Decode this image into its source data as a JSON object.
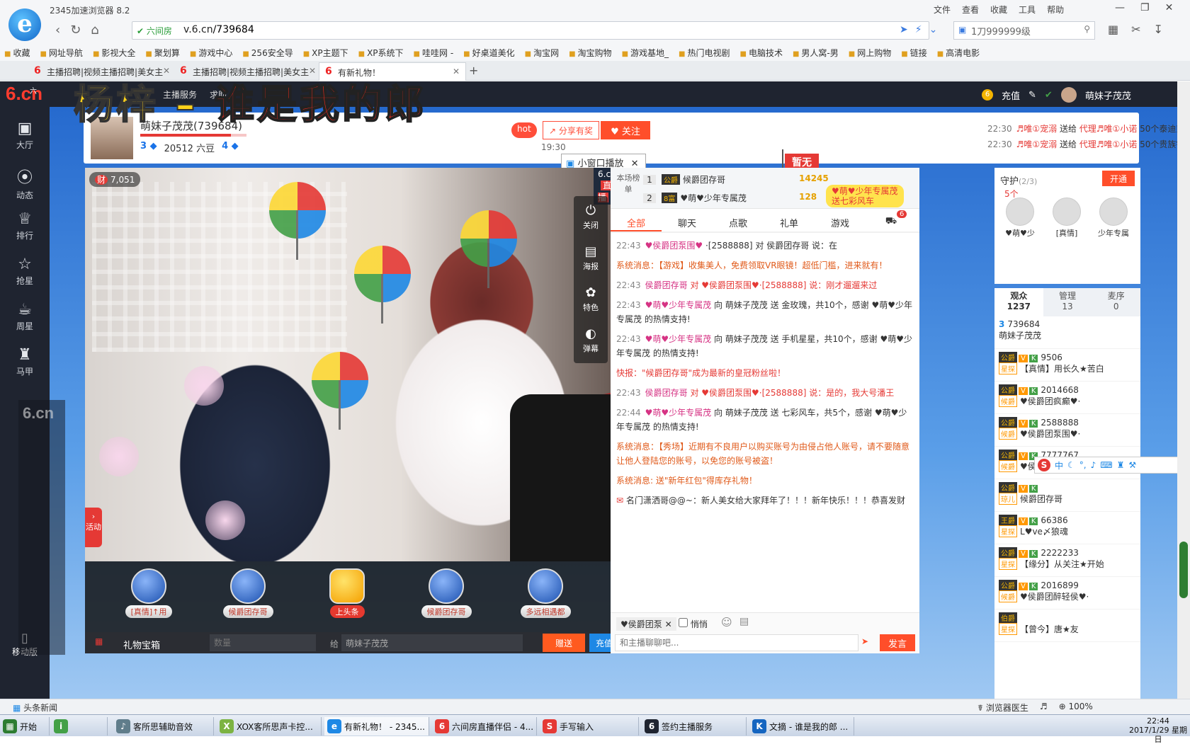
{
  "browser": {
    "title": "2345加速浏览器 8.2",
    "menu": [
      "文件",
      "查看",
      "收藏",
      "工具",
      "帮助"
    ],
    "safe_label": "六间房",
    "url_host": "v.6.cn",
    "url_path": "/739684",
    "search_value": "1刀999999级",
    "bookmarks": [
      "收藏",
      "网址导航",
      "影视大全",
      "聚划算",
      "游戏中心",
      "256安全导",
      "XP主题下",
      "XP系统下",
      "哇哇网 -",
      "好桌道美化",
      "淘宝网",
      "淘宝购物",
      "游戏基地_",
      "热门电视剧",
      "电脑技术",
      "男人窝-男",
      "网上购物",
      "链接",
      "高清电影"
    ],
    "tabs": [
      {
        "label": "主播招聘|视频主播招聘|美女主"
      },
      {
        "label": "主播招聘|视频主播招聘|美女主"
      },
      {
        "label": "有新礼物！"
      }
    ]
  },
  "site": {
    "logo_main": "6.cn",
    "logo_small": "六间房",
    "nav_links": [
      "主播服务",
      "求助"
    ],
    "recharge": "充值",
    "username": "萌妹子茂茂"
  },
  "sidebar": [
    {
      "label": "大厅",
      "icon": "tv-icon"
    },
    {
      "label": "动态",
      "icon": "compass-icon"
    },
    {
      "label": "排行",
      "icon": "crown-icon"
    },
    {
      "label": "抢星",
      "icon": "star-icon"
    },
    {
      "label": "周星",
      "icon": "cup-icon"
    },
    {
      "label": "马甲",
      "icon": "shirt-icon"
    }
  ],
  "overlay_title": {
    "part1": "杨梓 – ",
    "part2": "谁是我的郎"
  },
  "host": {
    "name": "萌妹子茂茂(739684)",
    "level": "3",
    "beans": "20512 六豆",
    "fans_level": "4",
    "progress": 0.85,
    "hot": "hot",
    "share": "分享有奖",
    "follow": "关注",
    "time": "19:30",
    "mini_play": "小窗口播放",
    "flag": "暂无"
  },
  "gift_ticker": [
    {
      "time": "22:30",
      "from": "♬唯①宠溺",
      "verb": "送给",
      "to": "代理♬唯①小诺",
      "gift": "50个泰迪熊"
    },
    {
      "time": "22:30",
      "from": "♬唯①宠溺",
      "verb": "送给",
      "to": "代理♬唯①小诺",
      "gift": "50个贵族钻戒"
    }
  ],
  "video": {
    "viewers": "7,051",
    "brand": "6.cn",
    "live": "直播",
    "controls": [
      {
        "label": "关闭",
        "icon": "power-icon"
      },
      {
        "label": "海报",
        "icon": "image-icon"
      },
      {
        "label": "特色",
        "icon": "sparkle-icon"
      },
      {
        "label": "弹幕",
        "icon": "toggle-icon"
      }
    ],
    "activity": "活动"
  },
  "gift_slots": [
    {
      "label": "[真情]↑用"
    },
    {
      "label": "候爵团存哥"
    },
    {
      "label": "上头条"
    },
    {
      "label": "候爵团存哥"
    },
    {
      "label": "多远相遇都"
    }
  ],
  "gift_controls": {
    "box": "礼物宝箱",
    "quantity_placeholder": "数量",
    "to_label": "给",
    "to_value": "萌妹子茂茂",
    "give": "赠送",
    "recharge": "充值"
  },
  "rank": {
    "label": "本场榜单",
    "rows": [
      {
        "n": "1",
        "lv": "公爵",
        "name": "候爵团存哥",
        "pts": "14245"
      },
      {
        "n": "2",
        "lv": "8富",
        "name": "♥萌♥少年专属茂",
        "pts": "128"
      }
    ],
    "float_msg1": "♥萌♥少年专属茂",
    "float_msg2": "送七彩风车",
    "float_count": "5个"
  },
  "chat_tabs": [
    "全部",
    "聊天",
    "点歌",
    "礼单",
    "游戏"
  ],
  "chat_badge": "6",
  "messages": [
    {
      "t": "22:43",
      "u": "♥侯爵团泵围♥",
      "text": "·[2588888] 对 侯爵团存哥 说：在"
    },
    {
      "t": "",
      "u": "",
      "sys": "系统消息：【游戏】收集美人，免费领取VR眼镜！超低门槛，进来就有！"
    },
    {
      "t": "22:43",
      "u": "侯爵团存哥",
      "text": "对 ♥侯爵团泵围♥·[2588888] 说：刚才遛遛来过"
    },
    {
      "t": "22:43",
      "u": "♥萌♥少年专属茂",
      "text": "向 萌妹子茂茂 送 金玫瑰，共10个，感谢 ♥萌♥少年专属茂 的热情支持!"
    },
    {
      "t": "22:43",
      "u": "♥萌♥少年专属茂",
      "text": "向 萌妹子茂茂 送 手机星星，共10个，感谢 ♥萌♥少年专属茂 的热情支持!"
    },
    {
      "t": "",
      "u": "",
      "notice": "快报：\"候爵团存哥\"成为最新的皇冠粉丝啦！"
    },
    {
      "t": "22:43",
      "u": "侯爵团存哥",
      "text": "对 ♥侯爵团泵围♥·[2588888] 说：是的，我大号潘王"
    },
    {
      "t": "22:44",
      "u": "♥萌♥少年专属茂",
      "text": "向 萌妹子茂茂 送 七彩风车，共5个，感谢 ♥萌♥少年专属茂 的热情支持!"
    },
    {
      "t": "",
      "u": "",
      "sys": "系统消息：【秀场】近期有不良用户以购买账号为由侵占他人账号，请不要随意让他人登陆您的账号，以免您的账号被盗！"
    },
    {
      "t": "",
      "u": "",
      "sys": "系统消息: 送\"新年红包\"得库存礼物！"
    },
    {
      "t": "",
      "u": "",
      "plain": "名门潇洒哥@@~：新人美女给大家拜年了！！！新年快乐！！！恭喜发财"
    }
  ],
  "chat_input": {
    "target": "♥侯爵团泵",
    "whisper": "悄悄",
    "placeholder": "和主播聊聊吧...",
    "send": "发言"
  },
  "guard": {
    "title": "守护",
    "count": "(2/3)",
    "open": "开通",
    "members": [
      "♥萌♥少",
      "[真情]",
      "少年专属"
    ]
  },
  "viewer_tabs": [
    {
      "label": "观众",
      "count": "1237"
    },
    {
      "label": "管理",
      "count": "13"
    },
    {
      "label": "麦序",
      "count": "0"
    }
  ],
  "viewers": [
    {
      "lv": "3",
      "id": "739684",
      "name": "萌妹子茂茂",
      "tag": ""
    },
    {
      "lv": "公爵",
      "id": "9506",
      "name": "【真情】用长久★苦白",
      "tag": "星探"
    },
    {
      "lv": "公爵",
      "id": "2014668",
      "name": "♥侯爵团疯癫♥·",
      "tag": "候爵"
    },
    {
      "lv": "公爵",
      "id": "2588888",
      "name": "♥侯爵团泵围♥·",
      "tag": "候爵"
    },
    {
      "lv": "公爵",
      "id": "7777767",
      "name": "♥侯爵团林易哥♥·",
      "tag": "候爵"
    },
    {
      "lv": "公爵",
      "id": "",
      "name": "候爵团存哥",
      "tag": "琼儿"
    },
    {
      "lv": "王爵",
      "id": "66386",
      "name": "L♥ve〆狼魂",
      "tag": "星探"
    },
    {
      "lv": "公爵",
      "id": "2222233",
      "name": "【缘分】从关注★开始",
      "tag": "星探"
    },
    {
      "lv": "公爵",
      "id": "2016899",
      "name": "♥侯爵团醉轻侯♥·",
      "tag": "候爵"
    },
    {
      "lv": "伯爵",
      "id": "",
      "name": "【曾今】唐★友",
      "tag": "星探"
    }
  ],
  "mobile": "移动版",
  "statusbar": {
    "news": "头条新闻",
    "doctor": "浏览器医生",
    "zoom": "100%"
  },
  "taskbar": [
    {
      "label": "开始"
    },
    {
      "label": ""
    },
    {
      "label": "客所思辅助音效"
    },
    {
      "label": "XOX客所思声卡控..."
    },
    {
      "label": "有新礼物！ - 2345..."
    },
    {
      "label": "六间房直播伴侣 - 4..."
    },
    {
      "label": "手写输入"
    },
    {
      "label": "签约主播服务"
    },
    {
      "label": "文摘 - 谁是我的郎 ..."
    }
  ],
  "clock": {
    "time": "22:44",
    "date": "2017/1/29 星期日"
  },
  "colors": {
    "accent": "#ff4e2a",
    "nav_bg": "#1f2430",
    "page_bg": "#2266cc"
  }
}
